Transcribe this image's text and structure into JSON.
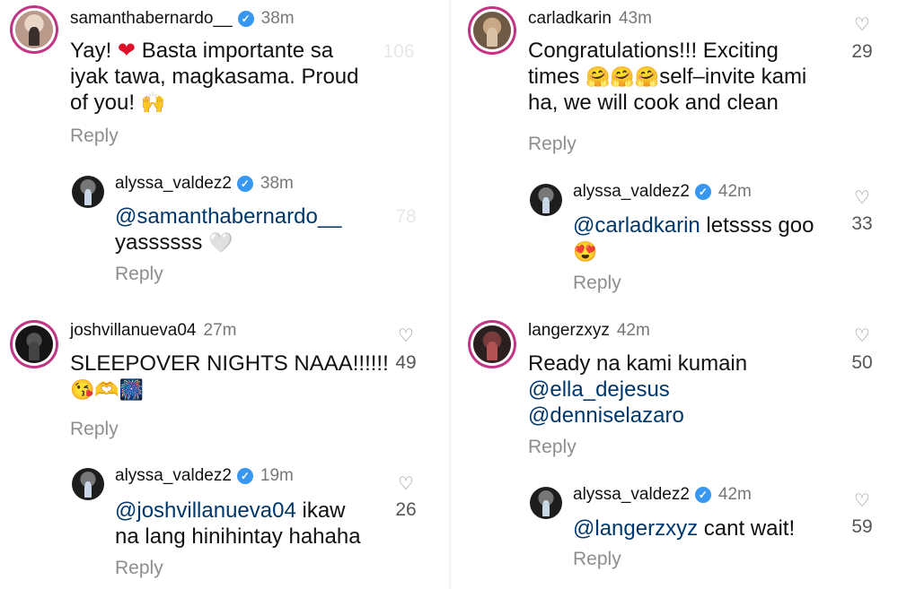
{
  "left_column": {
    "c1": {
      "username": "samanthabernardo__",
      "time": "38m",
      "text_1": "Yay! ",
      "text_heart": "❤",
      "text_2": " Basta importante sa\niyak tawa, magkasama. Proud\nof you! ",
      "text_emoji": "🙌",
      "reply_label": "Reply",
      "likes": "106"
    },
    "c1_reply": {
      "username": "alyssa_valdez2",
      "time": "38m",
      "mention": "@samanthabernardo__",
      "text": "yassssss ",
      "text_emoji": "🤍",
      "reply_label": "Reply",
      "likes": "78"
    },
    "c2": {
      "username": "joshvillanueva04",
      "time": "27m",
      "text": "SLEEPOVER NIGHTS NAAA!!!!!!",
      "emojis": "😘🫶🎆",
      "reply_label": "Reply",
      "likes": "49"
    },
    "c2_reply": {
      "username": "alyssa_valdez2",
      "time": "19m",
      "mention": "@joshvillanueva04",
      "text": " ikaw\nna lang hinihintay hahaha",
      "reply_label": "Reply",
      "likes": "26"
    }
  },
  "right_column": {
    "c1": {
      "username": "carladkarin",
      "time": "43m",
      "text_1": "Congratulations!!! Exciting\ntimes ",
      "text_emoji": "🤗🤗🤗",
      "text_2": "self–invite kami\nha, we will cook and clean",
      "reply_label": "Reply",
      "likes": "29"
    },
    "c1_reply": {
      "username": "alyssa_valdez2",
      "time": "42m",
      "mention": "@carladkarin",
      "text": " letssss goo",
      "text_emoji": "😍",
      "reply_label": "Reply",
      "likes": "33"
    },
    "c2": {
      "username": "langerzxyz",
      "time": "42m",
      "text": "Ready na kami kumain",
      "mention_1": "@ella_dejesus",
      "mention_2": "@denniselazaro",
      "reply_label": "Reply",
      "likes": "50"
    },
    "c2_reply": {
      "username": "alyssa_valdez2",
      "time": "42m",
      "mention": "@langerzxyz",
      "text": " cant wait!",
      "reply_label": "Reply",
      "likes": "59"
    }
  },
  "icons": {
    "verified": "verified-badge-icon",
    "heart": "heart-outline-icon"
  },
  "colors": {
    "mention": "#00376b",
    "verified": "#3897f0",
    "muted": "#8e8e8e"
  }
}
